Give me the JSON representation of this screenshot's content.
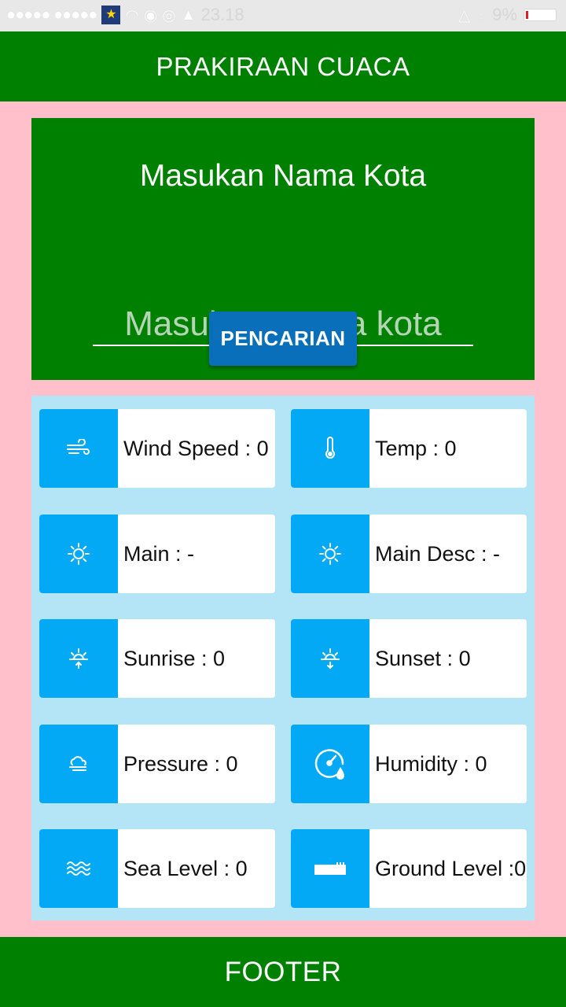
{
  "status_bar": {
    "time": "23.18",
    "battery": "9%"
  },
  "header": {
    "title": "PRAKIRAAN CUACA"
  },
  "search": {
    "heading": "Masukan Nama Kota",
    "input_placeholder": "Masukan Nama kota",
    "input_value": "",
    "button_label": "PENCARIAN"
  },
  "weather": {
    "cards": [
      {
        "label": "Wind Speed : 0",
        "icon": "wind-icon"
      },
      {
        "label": "Temp : 0",
        "icon": "thermometer-icon"
      },
      {
        "label": "Main : -",
        "icon": "sun-icon"
      },
      {
        "label": "Main Desc : -",
        "icon": "sun-icon"
      },
      {
        "label": "Sunrise : 0",
        "icon": "sunrise-icon"
      },
      {
        "label": "Sunset : 0",
        "icon": "sunset-icon"
      },
      {
        "label": "Pressure : 0",
        "icon": "cloud-wind-icon"
      },
      {
        "label": "Humidity : 0",
        "icon": "humidity-gauge-icon"
      },
      {
        "label": "Sea Level : 0",
        "icon": "waves-icon"
      },
      {
        "label": "Ground Level :0",
        "icon": "ground-icon"
      }
    ]
  },
  "footer": {
    "label": "FOOTER"
  },
  "colors": {
    "primary_green": "#008000",
    "background_pink": "#ffc0cb",
    "panel_light_blue": "#b3e5f7",
    "icon_blue": "#03a9f4",
    "button_blue": "#0a6fbb"
  }
}
